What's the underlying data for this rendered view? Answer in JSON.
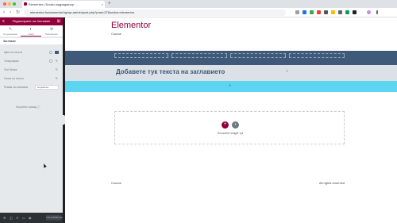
{
  "browser": {
    "tab_title": "Elementor | Блоки подредактор ...",
    "tab_close": "×",
    "new_tab": "+",
    "url": "elementor.fundamental.bg/wp-admin/post.php?post=37&action=elementor",
    "nav_back": "‹",
    "nav_forward": "›",
    "nav_reload": "↻"
  },
  "panel": {
    "title": "Редактиране на Заглавие",
    "tabs": [
      {
        "icon": "✎",
        "label": "Съдържание"
      },
      {
        "icon": "◐",
        "label": "Стил"
      },
      {
        "icon": "⚙",
        "label": "Разширени"
      }
    ],
    "section": "Заглавие",
    "controls": [
      {
        "label": "Цвят на текста"
      },
      {
        "label": "Типография"
      },
      {
        "label": "Text Stroke"
      },
      {
        "label": "Сянка на текста"
      },
      {
        "label": "Режим на смесване",
        "value": "Нормален"
      }
    ],
    "help": "Потребно помощ",
    "update_label": "ОБНОВЯВАНЕ"
  },
  "site": {
    "title": "Elementor",
    "tagline": "Course",
    "heading": "Добавете тук текста на заглавието",
    "drag_hint": "Плъзнете widget тук",
    "footer_left": "Course",
    "footer_right": "All rights reserved",
    "add_icon": "+",
    "folder_icon": "▪"
  },
  "colors": {
    "brand": "#92003b",
    "section_dark": "#3e5a78",
    "section_cyan": "#5bd5f0"
  }
}
